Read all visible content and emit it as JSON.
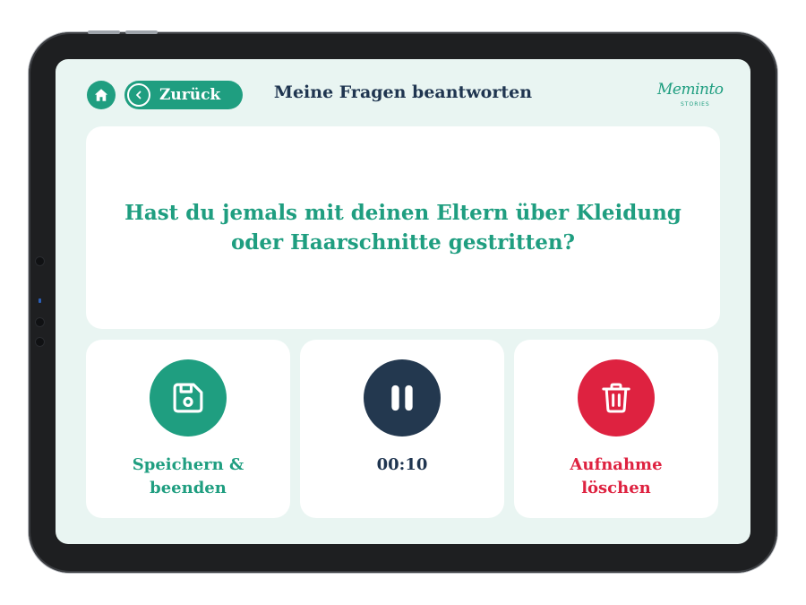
{
  "header": {
    "back_label": "Zurück",
    "title": "Meine Fragen beantworten",
    "logo_text": "Meminto",
    "logo_subtext": "STORIES"
  },
  "question": {
    "line1": "Hast du jemals mit deinen Eltern über Kleidung",
    "line2": "oder Haarschnitte gestritten?"
  },
  "actions": {
    "save_line1": "Speichern &",
    "save_line2": "beenden",
    "timer": "00:10",
    "delete_line1": "Aufnahme",
    "delete_line2": "löschen"
  },
  "icons": {
    "home": "home-icon",
    "back": "chevron-left-icon",
    "save": "floppy-disk-icon",
    "pause": "pause-icon",
    "delete": "trash-icon"
  },
  "colors": {
    "accent_green": "#1f9e80",
    "navy": "#23384f",
    "danger_red": "#de2240",
    "screen_bg": "#e9f5f2"
  }
}
